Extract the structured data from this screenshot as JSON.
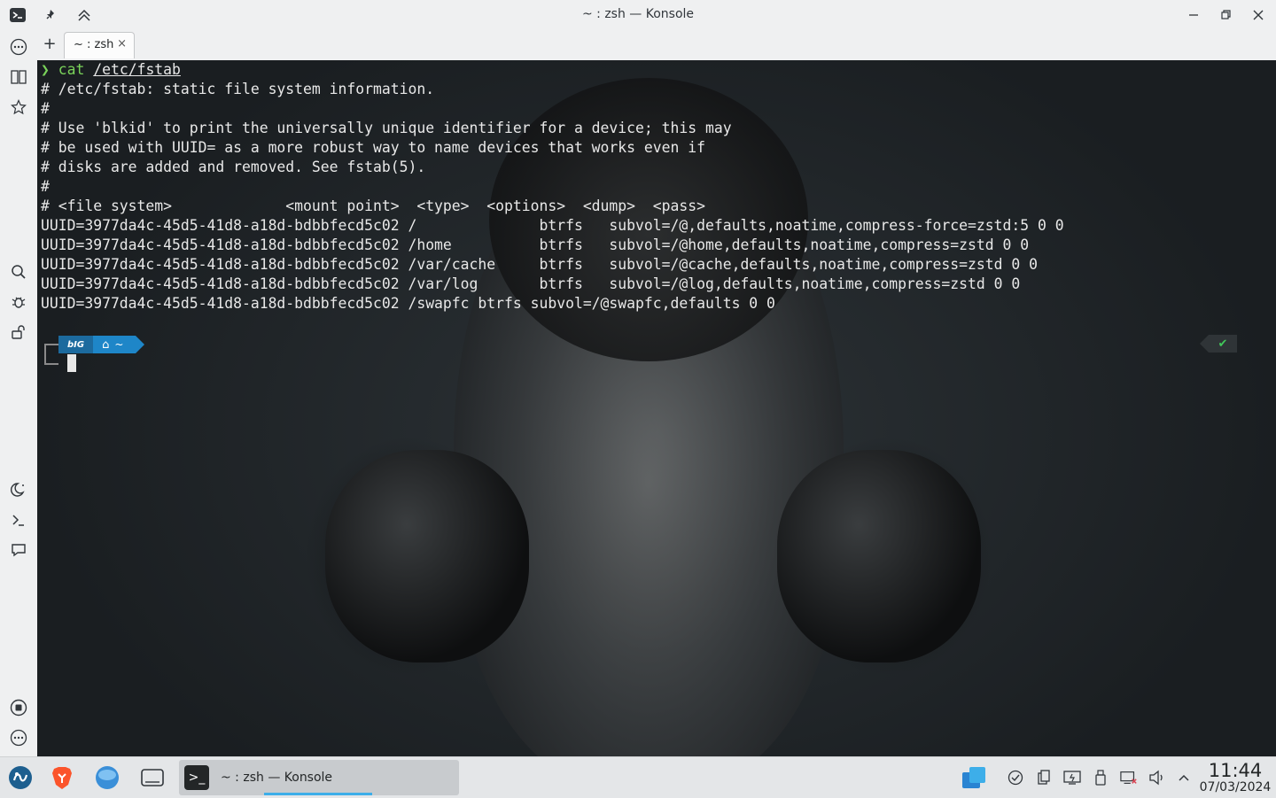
{
  "window": {
    "title": "~ : zsh — Konsole",
    "minimize_icon": "minimize-icon",
    "maximize_icon": "restore-icon",
    "close_icon": "close-icon"
  },
  "tabs": {
    "add_icon": "plus-icon",
    "active_label": "~ : zsh",
    "close_glyph": "×"
  },
  "terminal": {
    "command": {
      "prompt_glyph": "❯",
      "cmd": "cat",
      "arg": "/etc/fstab"
    },
    "output": [
      "# /etc/fstab: static file system information.",
      "#",
      "# Use 'blkid' to print the universally unique identifier for a device; this may",
      "# be used with UUID= as a more robust way to name devices that works even if",
      "# disks are added and removed. See fstab(5).",
      "#",
      "# <file system>             <mount point>  <type>  <options>  <dump>  <pass>",
      "UUID=3977da4c-45d5-41d8-a18d-bdbbfecd5c02 /              btrfs   subvol=/@,defaults,noatime,compress-force=zstd:5 0 0",
      "UUID=3977da4c-45d5-41d8-a18d-bdbbfecd5c02 /home          btrfs   subvol=/@home,defaults,noatime,compress=zstd 0 0",
      "UUID=3977da4c-45d5-41d8-a18d-bdbbfecd5c02 /var/cache     btrfs   subvol=/@cache,defaults,noatime,compress=zstd 0 0",
      "UUID=3977da4c-45d5-41d8-a18d-bdbbfecd5c02 /var/log       btrfs   subvol=/@log,defaults,noatime,compress=zstd 0 0",
      "UUID=3977da4c-45d5-41d8-a18d-bdbbfecd5c02 /swapfc btrfs subvol=/@swapfc,defaults 0 0"
    ],
    "ps1": {
      "logo": "bIG",
      "home_glyph": "⌂",
      "dir": "~"
    },
    "right_status": "✔"
  },
  "taskbar": {
    "active_task_label": "~ : zsh — Konsole",
    "clock_time": "11:44",
    "clock_date": "07/03/2024"
  },
  "colors": {
    "accent": "#3daee9",
    "prompt_green": "#7ad35a"
  }
}
